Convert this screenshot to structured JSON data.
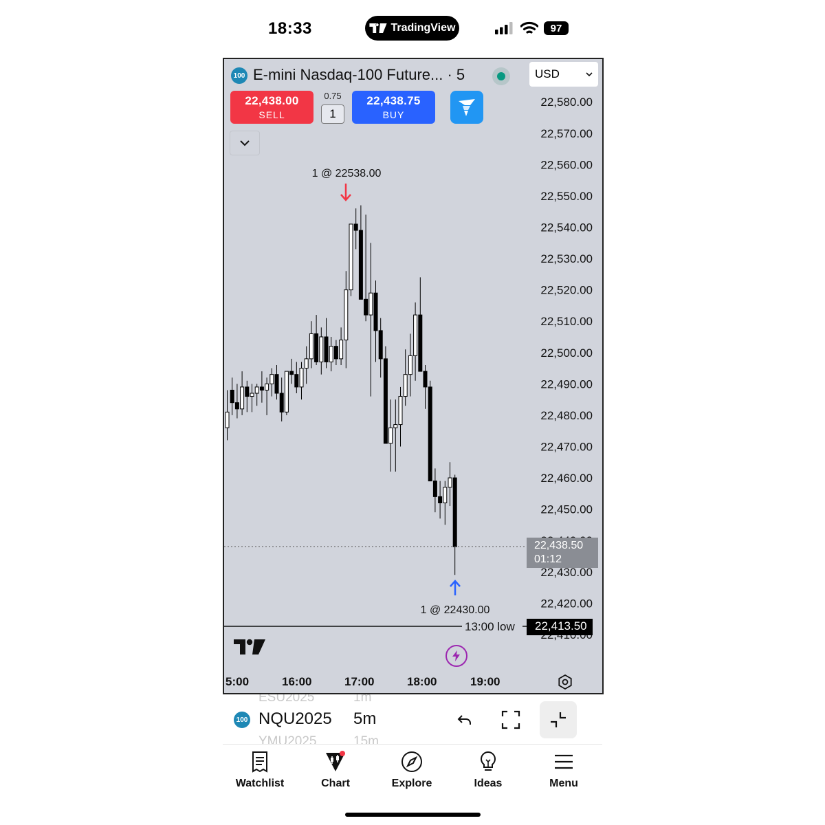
{
  "status_bar": {
    "time": "18:33",
    "app_pill": "TradingView",
    "battery": "97"
  },
  "chart": {
    "symbol_badge": "100",
    "title": "E-mini Nasdaq-100 Future... · 5",
    "currency": "USD",
    "sell": {
      "price": "22,438.00",
      "label": "SELL"
    },
    "buy": {
      "price": "22,438.75",
      "label": "BUY"
    },
    "spread": "0.75",
    "quantity": "1",
    "sell_execution": "1 @ 22538.00",
    "buy_execution": "1 @ 22430.00",
    "current_price": {
      "price": "22,438.50",
      "countdown": "01:12"
    },
    "low_line": {
      "label": "13:00 low",
      "price": "22,413.50"
    },
    "colors": {
      "background": "#d1d4dc",
      "sell": "#f23645",
      "buy": "#2962ff",
      "live": "#089981"
    }
  },
  "chart_data": {
    "type": "candlestick",
    "y_ticks": [
      "22,580.00",
      "22,570.00",
      "22,560.00",
      "22,550.00",
      "22,540.00",
      "22,530.00",
      "22,520.00",
      "22,510.00",
      "22,500.00",
      "22,490.00",
      "22,480.00",
      "22,470.00",
      "22,460.00",
      "22,450.00",
      "22,440.00",
      "22,430.00",
      "22,420.00",
      "22,410.00"
    ],
    "ylim": [
      22408,
      22584
    ],
    "x_ticks": [
      "5:00",
      "16:00",
      "17:00",
      "18:00",
      "19:00"
    ],
    "candles": [
      [
        22476,
        22488,
        22472,
        22481
      ],
      [
        22488,
        22492,
        22480,
        22484
      ],
      [
        22484,
        22490,
        22479,
        22482
      ],
      [
        22482,
        22494,
        22480,
        22489
      ],
      [
        22489,
        22491,
        22481,
        22486
      ],
      [
        22486,
        22490,
        22481,
        22487
      ],
      [
        22487,
        22490,
        22483,
        22489
      ],
      [
        22489,
        22494,
        22484,
        22488
      ],
      [
        22488,
        22492,
        22480,
        22490
      ],
      [
        22490,
        22495,
        22486,
        22493
      ],
      [
        22493,
        22496,
        22485,
        22487
      ],
      [
        22487,
        22492,
        22478,
        22481
      ],
      [
        22481,
        22494,
        22480,
        22494
      ],
      [
        22494,
        22498,
        22490,
        22493
      ],
      [
        22493,
        22497,
        22487,
        22489
      ],
      [
        22489,
        22497,
        22485,
        22495
      ],
      [
        22495,
        22502,
        22490,
        22498
      ],
      [
        22498,
        22510,
        22495,
        22506
      ],
      [
        22506,
        22512,
        22496,
        22497
      ],
      [
        22497,
        22508,
        22493,
        22505
      ],
      [
        22505,
        22511,
        22495,
        22497
      ],
      [
        22497,
        22505,
        22494,
        22502
      ],
      [
        22502,
        22504,
        22496,
        22498
      ],
      [
        22498,
        22508,
        22496,
        22504
      ],
      [
        22504,
        22526,
        22495,
        22520
      ],
      [
        22520,
        22541,
        22518,
        22541
      ],
      [
        22541,
        22546,
        22533,
        22539
      ],
      [
        22539,
        22547,
        22520,
        22517
      ],
      [
        22517,
        22544,
        22510,
        22512
      ],
      [
        22512,
        22535,
        22486,
        22519
      ],
      [
        22519,
        22523,
        22497,
        22507
      ],
      [
        22507,
        22511,
        22492,
        22498
      ],
      [
        22498,
        22502,
        22471,
        22471
      ],
      [
        22471,
        22485,
        22462,
        22476
      ],
      [
        22476,
        22485,
        22462,
        22477
      ],
      [
        22477,
        22489,
        22470,
        22486
      ],
      [
        22486,
        22501,
        22483,
        22493
      ],
      [
        22493,
        22506,
        22486,
        22499
      ],
      [
        22499,
        22516,
        22491,
        22512
      ],
      [
        22512,
        22524,
        22494,
        22494
      ],
      [
        22494,
        22496,
        22482,
        22489
      ],
      [
        22489,
        22491,
        22459,
        22459
      ],
      [
        22459,
        22463,
        22449,
        22454
      ],
      [
        22454,
        22459,
        22447,
        22452
      ],
      [
        22452,
        22459,
        22445,
        22457
      ],
      [
        22457,
        22465,
        22451,
        22460
      ],
      [
        22460,
        22461,
        22429,
        22438
      ]
    ]
  },
  "toolbar": {
    "symbol_badge": "100",
    "symbol": "NQU2025",
    "interval": "5m",
    "ghost_symbol_above": "ESU2025",
    "ghost_interval_above": "1m",
    "ghost_symbol_below": "YMU2025",
    "ghost_interval_below": "15m"
  },
  "nav": {
    "items": [
      {
        "label": "Watchlist"
      },
      {
        "label": "Chart"
      },
      {
        "label": "Explore"
      },
      {
        "label": "Ideas"
      },
      {
        "label": "Menu"
      }
    ]
  }
}
